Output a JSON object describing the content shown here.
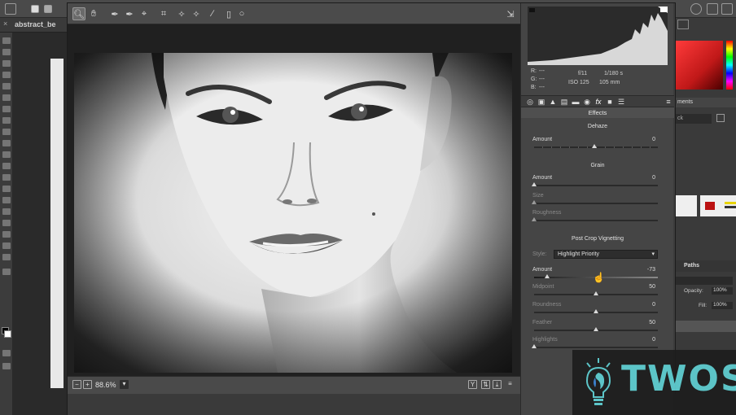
{
  "document_tab": "abstract_be",
  "status": {
    "zoom": "88.6%"
  },
  "metadata": {
    "r_label": "R:",
    "g_label": "G:",
    "b_label": "B:",
    "r_value": "---",
    "g_value": "---",
    "b_value": "---",
    "aperture": "f/11",
    "shutter": "1/180 s",
    "iso": "ISO 125",
    "focal": "105 mm"
  },
  "panel": {
    "title": "Effects",
    "dehaze": {
      "heading": "Dehaze",
      "amount_label": "Amount",
      "amount_value": "0"
    },
    "grain": {
      "heading": "Grain",
      "amount_label": "Amount",
      "amount_value": "0",
      "size_label": "Size",
      "roughness_label": "Roughness"
    },
    "vignette": {
      "heading": "Post Crop Vignetting",
      "style_label": "Style:",
      "style_value": "Highlight Priority",
      "amount_label": "Amount",
      "amount_value": "-73",
      "midpoint_label": "Midpoint",
      "midpoint_value": "50",
      "roundness_label": "Roundness",
      "roundness_value": "0",
      "feather_label": "Feather",
      "feather_value": "50",
      "highlights_label": "Highlights",
      "highlights_value": "0"
    }
  },
  "right_panel": {
    "tab_fragment": "ments",
    "search_fragment": "ck",
    "paths_tab": "Paths",
    "opacity_label": "Opacity:",
    "opacity_value": "100%",
    "fill_label": "Fill:",
    "fill_value": "100%"
  },
  "watermark": {
    "brand": "TWOS"
  },
  "colors": {
    "accent": "#5fd0d4",
    "panel": "#454545",
    "toolbar": "#4b4b4b"
  }
}
